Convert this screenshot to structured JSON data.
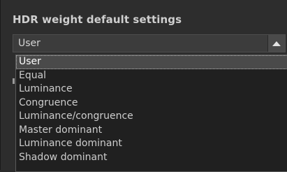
{
  "header": {
    "title": "HDR weight default settings"
  },
  "combo": {
    "value": "User",
    "button_icon": "up-arrow-icon"
  },
  "dropdown": {
    "items": [
      "User",
      "Equal",
      "Luminance",
      "Congruence",
      "Luminance/congruence",
      "Master dominant",
      "Luminance dominant",
      "Shadow dominant"
    ],
    "selected_index": 0
  },
  "colors": {
    "background": "#2d2d2d",
    "list_background": "#202020",
    "selection": "#4a4a4a",
    "text": "#cdcdcd"
  }
}
